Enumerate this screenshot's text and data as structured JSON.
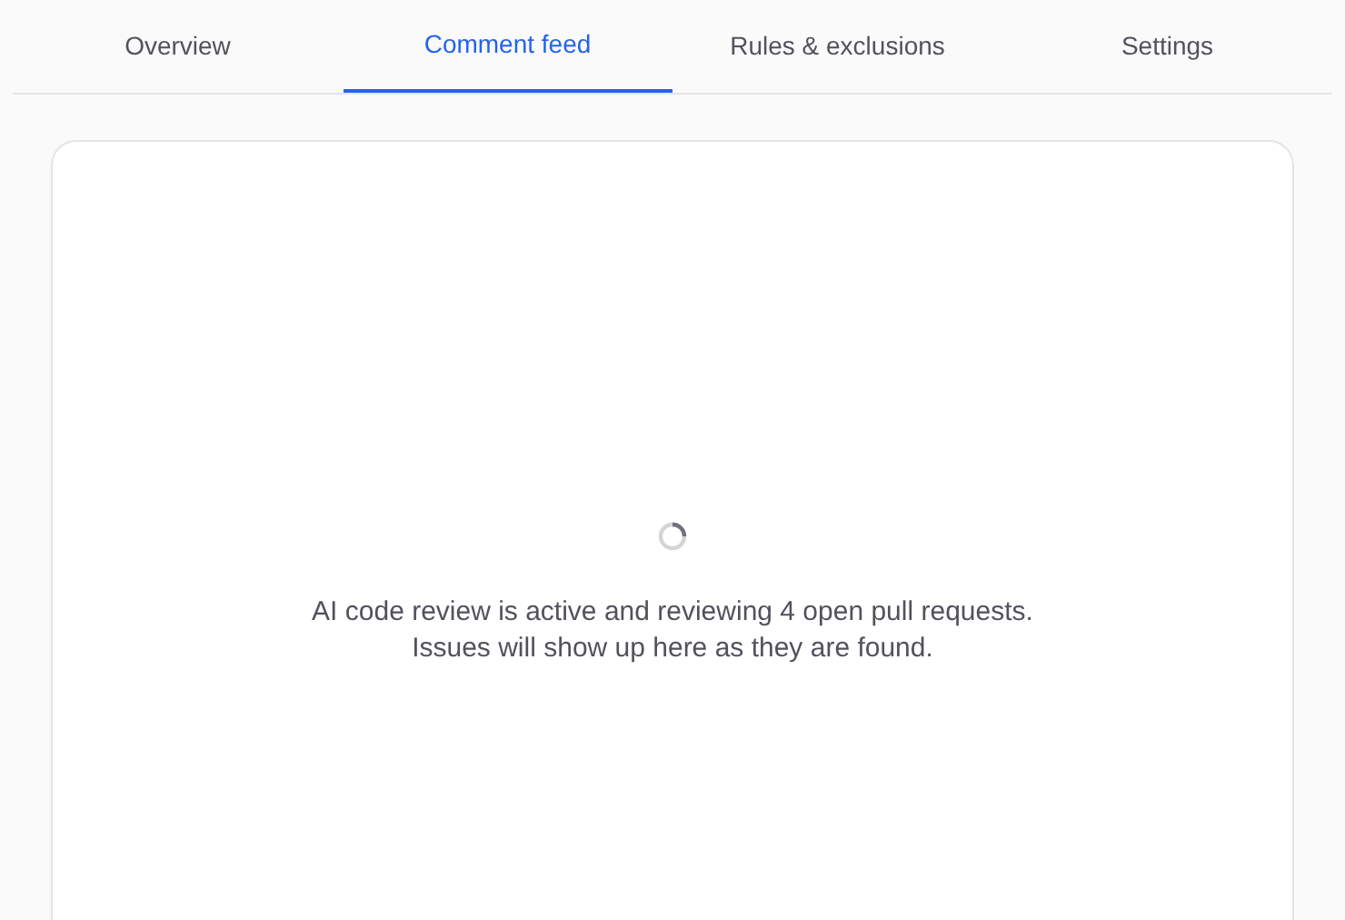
{
  "tabs": [
    {
      "label": "Overview",
      "selected": false
    },
    {
      "label": "Comment feed",
      "selected": true
    },
    {
      "label": "Rules & exclusions",
      "selected": false
    },
    {
      "label": "Settings",
      "selected": false
    }
  ],
  "feed": {
    "message": "AI code review is active and reviewing 4 open pull requests. Issues will show up here as they are found."
  }
}
